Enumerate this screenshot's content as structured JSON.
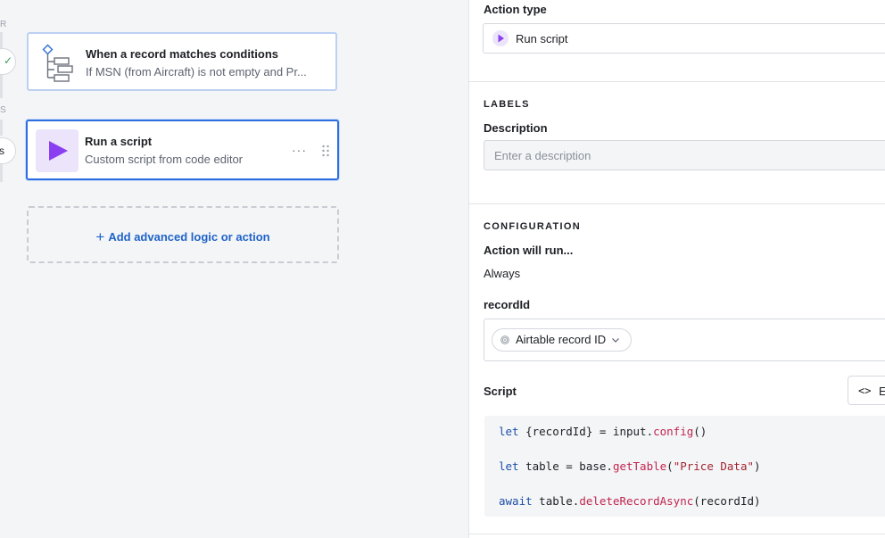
{
  "rail": {
    "letter_r": "R",
    "letter_s": "S",
    "partial_text": "s"
  },
  "trigger": {
    "title": "When a record matches conditions",
    "subtitle": "If MSN (from Aircraft) is not empty and Pr..."
  },
  "action": {
    "title": "Run a script",
    "subtitle": "Custom script from code editor",
    "more": "···"
  },
  "add_button": {
    "plus": "+",
    "label": "Add advanced logic or action"
  },
  "panel": {
    "action_type_label": "Action type",
    "action_type_value": "Run script",
    "labels_head": "LABELS",
    "description_label": "Description",
    "description_placeholder": "Enter a description",
    "description_value": "",
    "config_head": "CONFIGURATION",
    "action_run_label": "Action will run...",
    "action_run_value": "Always",
    "record_id_label": "recordId",
    "record_id_pill": "Airtable record ID",
    "script_label": "Script",
    "edit_button_label": "E",
    "code_icon_glyph": "<>"
  },
  "code": {
    "line1": {
      "kw": "let",
      "a": " {recordId} = input.",
      "fn": "config",
      "b": "()"
    },
    "line2": {
      "kw": "let",
      "a": " table = base.",
      "fn": "getTable",
      "b": "(",
      "str": "\"Price Data\"",
      "c": ")"
    },
    "line3": {
      "kw": "await",
      "a": " table.",
      "fn": "deleteRecordAsync",
      "b": "(recordId)"
    }
  },
  "colors": {
    "accent_blue": "#2d6fe0",
    "link_blue": "#1f63c9",
    "purple_play": "#8a3ff0",
    "purple_bg": "#ece4fb"
  },
  "icons": {
    "trigger": "conditions-tree-icon",
    "action": "play-icon",
    "record": "fingerprint-icon",
    "code": "code-icon"
  }
}
